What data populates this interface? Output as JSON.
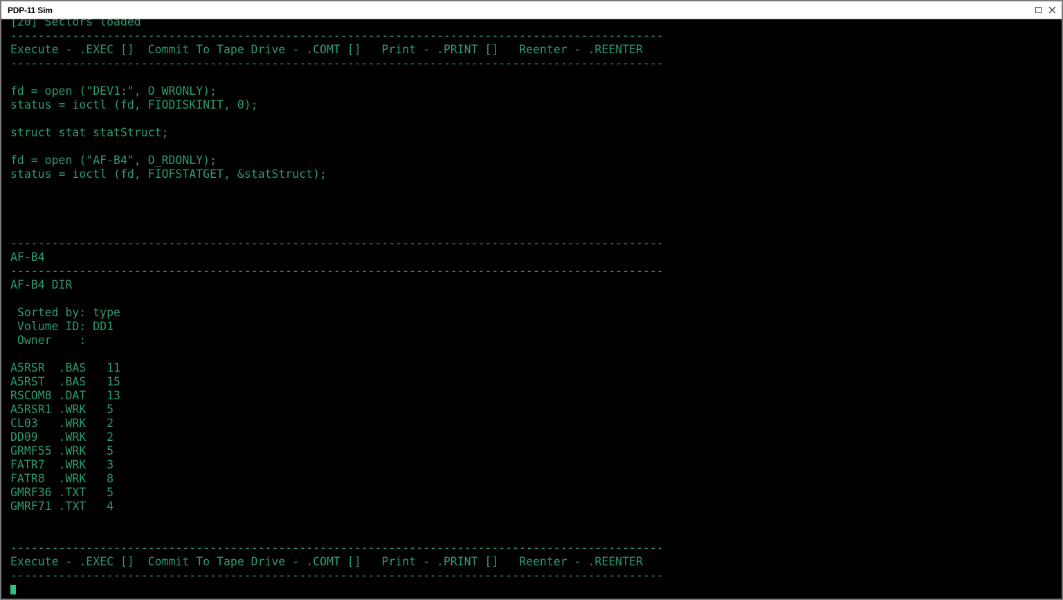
{
  "window": {
    "title": "PDP-11 Sim"
  },
  "icons": {
    "maximize": "maximize-icon",
    "close": "close-icon"
  },
  "colors": {
    "terminal_text": "#2f9a6e",
    "terminal_bg": "#000000",
    "cursor": "#27c47e"
  },
  "terminal": {
    "lines": [
      "[20] Sectors loaded",
      "-----------------------------------------------------------------------------------------------",
      "Execute - .EXEC []  Commit To Tape Drive - .COMT []   Print - .PRINT []   Reenter - .REENTER",
      "-----------------------------------------------------------------------------------------------",
      "",
      "fd = open (\"DEV1:\", O_WRONLY);",
      "status = ioctl (fd, FIODISKINIT, 0);",
      "",
      "struct stat statStruct;",
      "",
      "fd = open (\"AF-B4\", O_RDONLY);",
      "status = ioctl (fd, FIOFSTATGET, &statStruct);",
      "",
      "",
      "",
      "",
      "-----------------------------------------------------------------------------------------------",
      "AF-B4",
      "-----------------------------------------------------------------------------------------------",
      "AF-B4 DIR",
      "",
      " Sorted by: type",
      " Volume ID: DD1",
      " Owner    :",
      "",
      "A5RSR  .BAS   11",
      "A5RST  .BAS   15",
      "RSCOM8 .DAT   13",
      "A5RSR1 .WRK   5",
      "CL03   .WRK   2",
      "DD09   .WRK   2",
      "GRMF55 .WRK   5",
      "FATR7  .WRK   3",
      "FATR8  .WRK   8",
      "GMRF36 .TXT   5",
      "GMRF71 .TXT   4",
      "",
      "",
      "-----------------------------------------------------------------------------------------------",
      "Execute - .EXEC []  Commit To Tape Drive - .COMT []   Print - .PRINT []   Reenter - .REENTER",
      "-----------------------------------------------------------------------------------------------"
    ]
  }
}
